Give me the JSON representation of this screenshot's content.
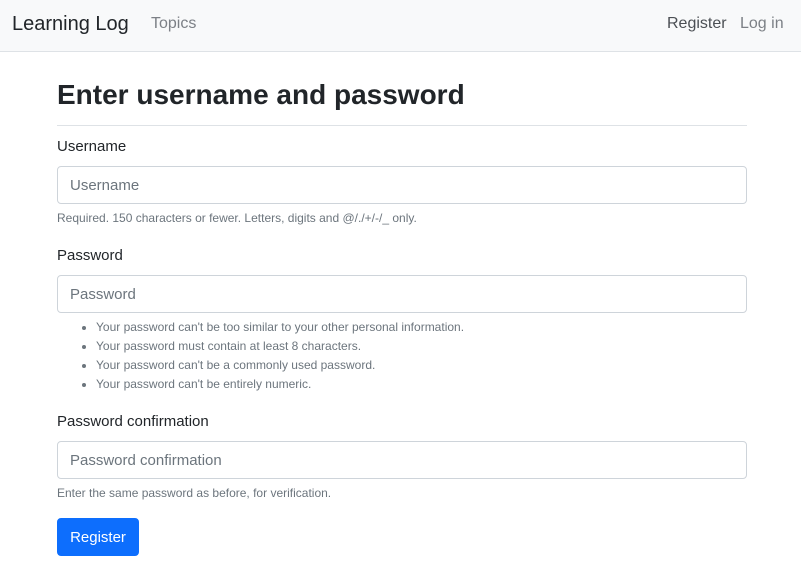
{
  "navbar": {
    "brand": "Learning Log",
    "links": {
      "topics": "Topics",
      "register": "Register",
      "login": "Log in"
    }
  },
  "page": {
    "title": "Enter username and password"
  },
  "form": {
    "username": {
      "label": "Username",
      "placeholder": "Username",
      "value": "",
      "help": "Required. 150 characters or fewer. Letters, digits and @/./+/-/_ only."
    },
    "password": {
      "label": "Password",
      "placeholder": "Password",
      "value": "",
      "help_items": [
        "Your password can't be too similar to your other personal information.",
        "Your password must contain at least 8 characters.",
        "Your password can't be a commonly used password.",
        "Your password can't be entirely numeric."
      ]
    },
    "password_confirmation": {
      "label": "Password confirmation",
      "placeholder": "Password confirmation",
      "value": "",
      "help": "Enter the same password as before, for verification."
    },
    "submit_label": "Register"
  },
  "colors": {
    "primary": "#0d6efd",
    "navbar_bg": "#f8f9fa",
    "muted_text": "#6c757d"
  }
}
